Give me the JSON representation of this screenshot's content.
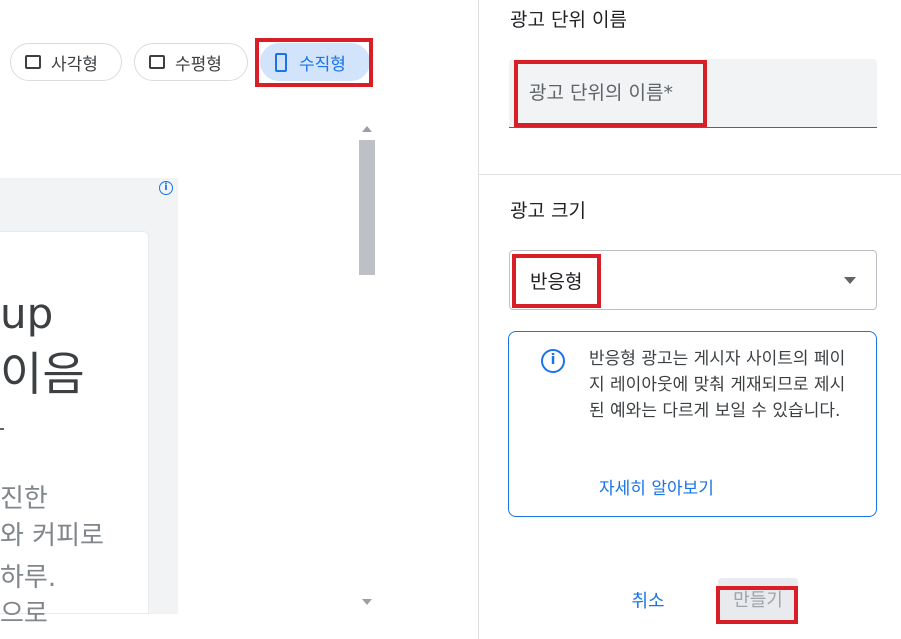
{
  "format_chips": [
    {
      "label": "사각형",
      "icon": "square-icon"
    },
    {
      "label": "수평형",
      "icon": "horizontal-rect-icon"
    },
    {
      "label": "수직형",
      "icon": "vertical-rect-icon",
      "selected": true
    }
  ],
  "preview": {
    "headline_line1": "up",
    "headline_line2": "이음",
    "body_lines": [
      "진한",
      "와 커피로",
      "하루.",
      "으로"
    ],
    "ad_info_icon": "info-icon"
  },
  "ad_unit_name": {
    "section_title": "광고 단위 이름",
    "placeholder": "광고 단위의 이름*",
    "value": ""
  },
  "ad_size": {
    "section_title": "광고 크기",
    "selected": "반응형"
  },
  "info_notice": {
    "text": "반응형 광고는 게시자 사이트의 페이지 레이아웃에 맞춰 게재되므로 제시된 예와는 다르게 보일 수 있습니다.",
    "link": "자세히 알아보기"
  },
  "actions": {
    "cancel": "취소",
    "create": "만들기"
  },
  "colors": {
    "accent": "#1a73e8",
    "highlight_box": "#d81e27",
    "selected_chip_bg": "#d2e3fc"
  }
}
